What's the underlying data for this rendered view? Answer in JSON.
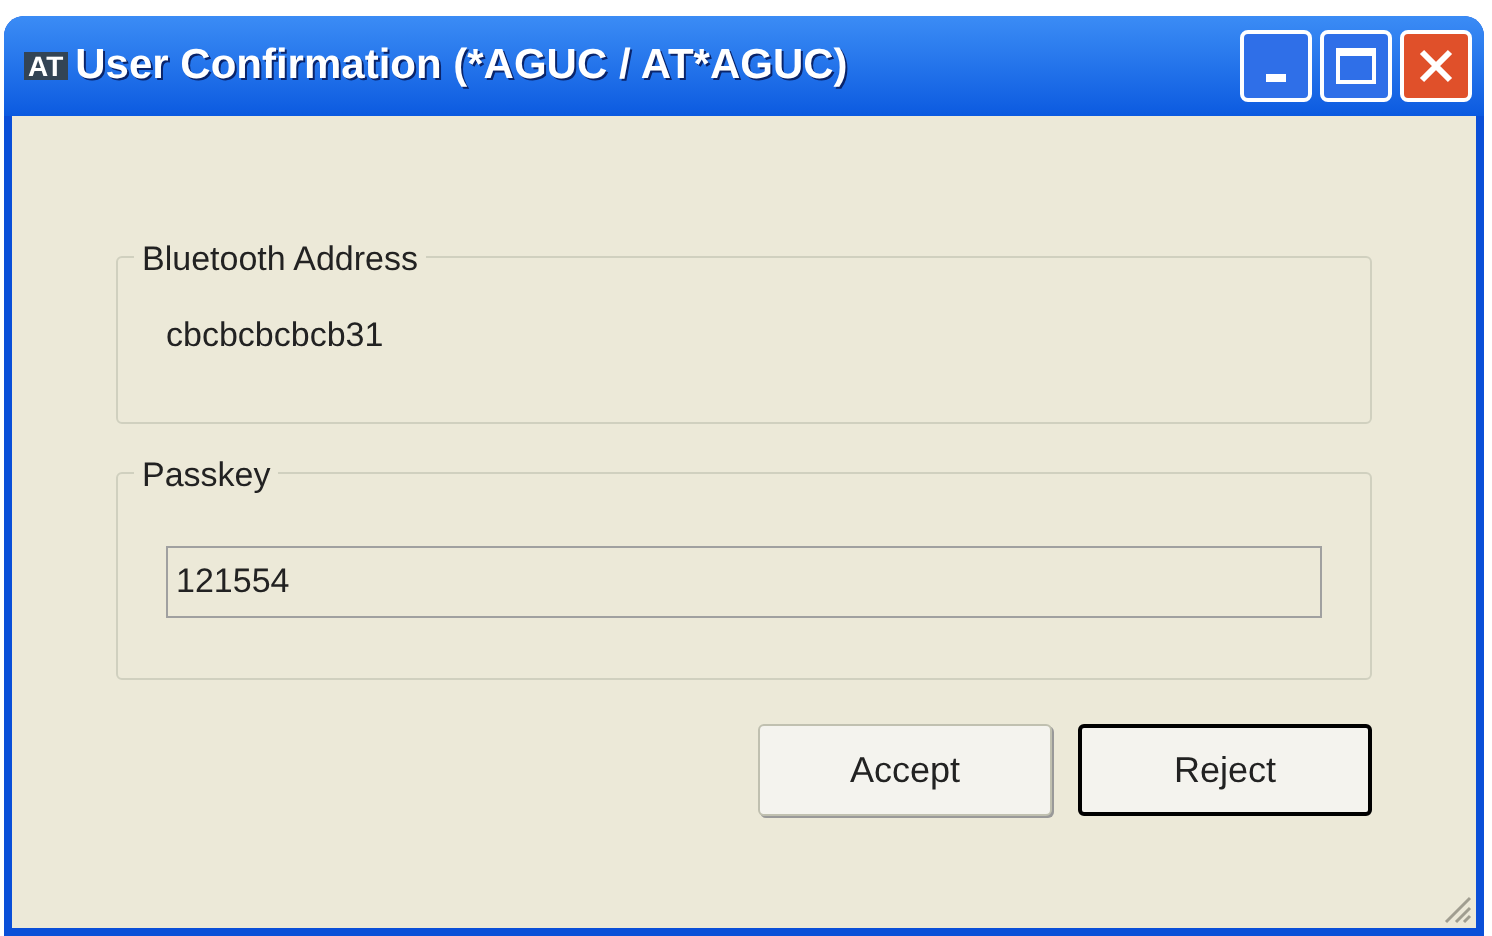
{
  "window": {
    "icon_text": "AT",
    "title": "User Confirmation (*AGUC / AT*AGUC)"
  },
  "groups": [
    {
      "legend": "Bluetooth Address",
      "kind": "text",
      "value": "cbcbcbcbcb31"
    },
    {
      "legend": "Passkey",
      "kind": "field",
      "value": "121554"
    }
  ],
  "buttons": [
    {
      "label": "Accept",
      "default": false
    },
    {
      "label": "Reject",
      "default": true
    }
  ]
}
